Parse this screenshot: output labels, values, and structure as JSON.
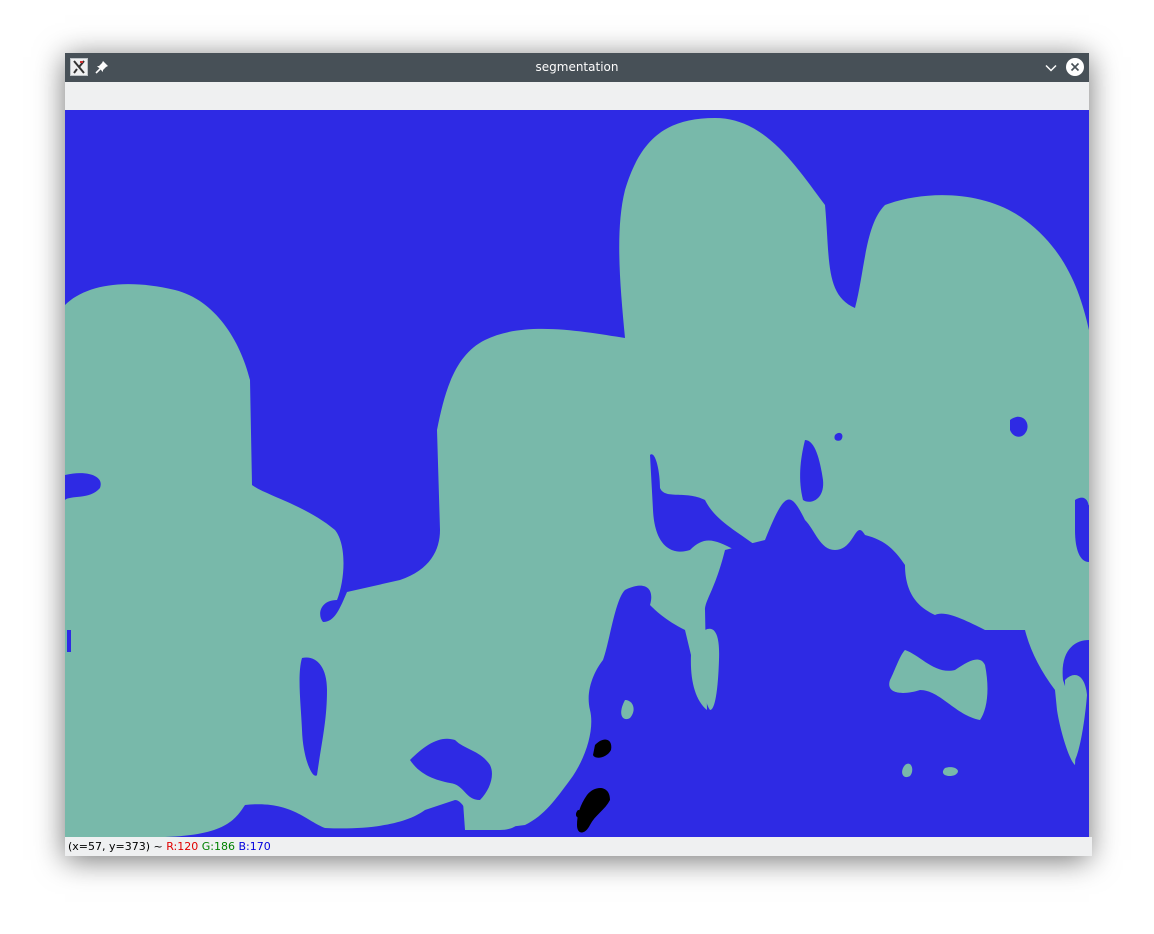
{
  "window": {
    "title": "segmentation"
  },
  "icons": {
    "app": "opencv-app-icon",
    "pin": "pin-icon",
    "minimize": "chevron-down-icon",
    "close": "close-icon"
  },
  "segmentation": {
    "colors": {
      "background_class": "#2e2ae4",
      "foreground_class": "#78b9aa",
      "unlabeled": "#000000"
    }
  },
  "status": {
    "coords": "(x=57, y=373) ~",
    "r": "R:120",
    "g": "G:186",
    "b": "B:170"
  }
}
